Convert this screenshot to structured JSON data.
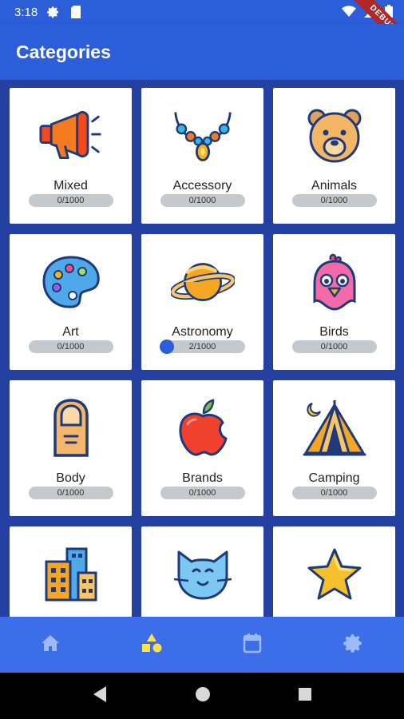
{
  "status": {
    "time": "3:18",
    "icons": [
      "settings-icon",
      "sd-card-icon",
      "wifi-icon",
      "signal-icon",
      "battery-icon"
    ]
  },
  "debug_label": "DEBUG",
  "appbar": {
    "title": "Categories"
  },
  "categories": [
    {
      "name": "Mixed",
      "progress": "0/1000",
      "done": 0,
      "icon": "megaphone-icon"
    },
    {
      "name": "Accessory",
      "progress": "0/1000",
      "done": 0,
      "icon": "necklace-icon"
    },
    {
      "name": "Animals",
      "progress": "0/1000",
      "done": 0,
      "icon": "bear-icon"
    },
    {
      "name": "Art",
      "progress": "0/1000",
      "done": 0,
      "icon": "palette-icon"
    },
    {
      "name": "Astronomy",
      "progress": "2/1000",
      "done": 2,
      "icon": "planet-icon"
    },
    {
      "name": "Birds",
      "progress": "0/1000",
      "done": 0,
      "icon": "bird-icon"
    },
    {
      "name": "Body",
      "progress": "0/1000",
      "done": 0,
      "icon": "finger-icon"
    },
    {
      "name": "Brands",
      "progress": "0/1000",
      "done": 0,
      "icon": "apple-icon"
    },
    {
      "name": "Camping",
      "progress": "0/1000",
      "done": 0,
      "icon": "tent-icon"
    },
    {
      "name": "",
      "progress": "",
      "done": 0,
      "icon": "buildings-icon"
    },
    {
      "name": "",
      "progress": "",
      "done": 0,
      "icon": "cat-icon"
    },
    {
      "name": "",
      "progress": "",
      "done": 0,
      "icon": "star-icon"
    }
  ],
  "bottom_nav": [
    "home-icon",
    "shapes-icon",
    "calendar-icon",
    "gear-icon"
  ],
  "colors": {
    "primary": "#2b5ed8",
    "background": "#2440a0",
    "nav": "#3b6ee8",
    "progress_track": "#c3c9cc"
  }
}
